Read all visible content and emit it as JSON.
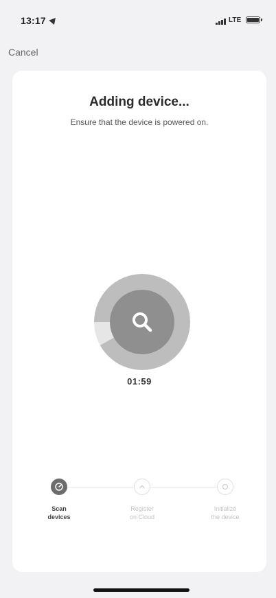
{
  "status_bar": {
    "time": "13:17",
    "network": "LTE",
    "battery_icon": "battery-full-icon",
    "signal_icon": "cellular-signal-icon",
    "location_icon": "location-arrow-icon"
  },
  "nav": {
    "cancel_label": "Cancel"
  },
  "header": {
    "title": "Adding device...",
    "subtitle": "Ensure that the device is powered on."
  },
  "scan": {
    "icon": "search-icon",
    "timer": "01:59",
    "progress_fraction": 0.92
  },
  "steps": [
    {
      "label_line1": "Scan",
      "label_line2": "devices",
      "state": "active",
      "icon": "scan-icon"
    },
    {
      "label_line1": "Register",
      "label_line2": "on Cloud",
      "state": "pending",
      "icon": "cloud-upload-icon"
    },
    {
      "label_line1": "Initialize",
      "label_line2": "the device",
      "state": "pending",
      "icon": "initialize-icon"
    }
  ],
  "colors": {
    "ring_progress": "#bdbdbd",
    "ring_track": "#e6e6e6",
    "active_step": "#6d6d6d",
    "search_circle": "#8f8f8f"
  }
}
